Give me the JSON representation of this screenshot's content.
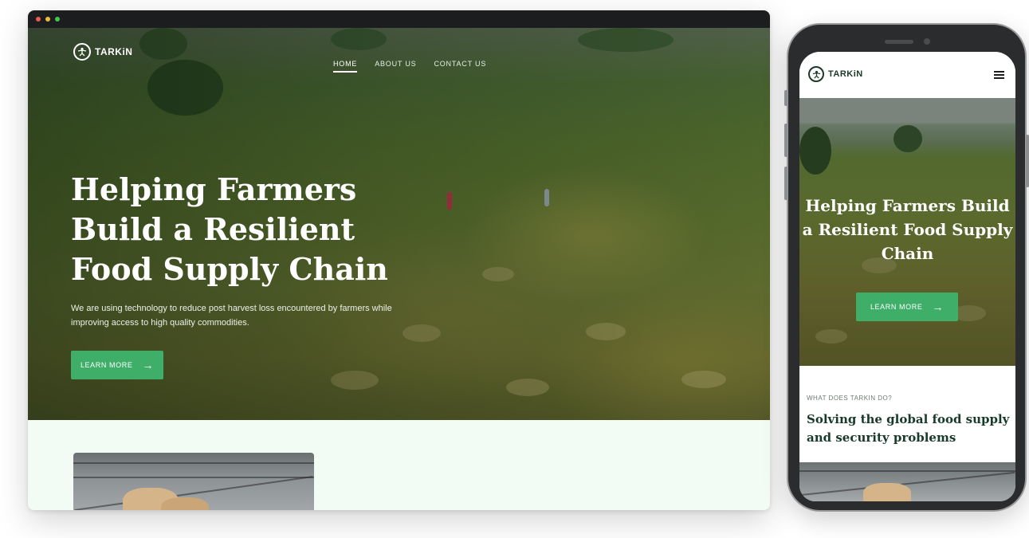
{
  "brand": {
    "name": "TARKiN"
  },
  "nav": {
    "items": [
      {
        "label": "HOME",
        "active": true
      },
      {
        "label": "ABOUT US",
        "active": false
      },
      {
        "label": "CONTACT US",
        "active": false
      }
    ]
  },
  "hero": {
    "title": "Helping Farmers Build a Resilient Food Supply Chain",
    "subtitle": "We are using technology to reduce post harvest loss encountered by farmers while improving access to high quality commodities.",
    "cta_label": "LEARN MORE"
  },
  "mobile": {
    "brand": "TARKiN",
    "hero_title": "Helping Farmers Build a Resilient Food Supply Chain",
    "cta_label": "LEARN MORE",
    "section_label": "WHAT DOES TARKIN DO?",
    "section_title": "Solving the global food supply and security problems"
  },
  "colors": {
    "accent_green": "#3fae69",
    "dark_green_text": "#183a2a",
    "page_tint": "#f3fcf4"
  },
  "icons": [
    "logo-icon",
    "arrow-right-icon",
    "hamburger-menu-icon"
  ]
}
